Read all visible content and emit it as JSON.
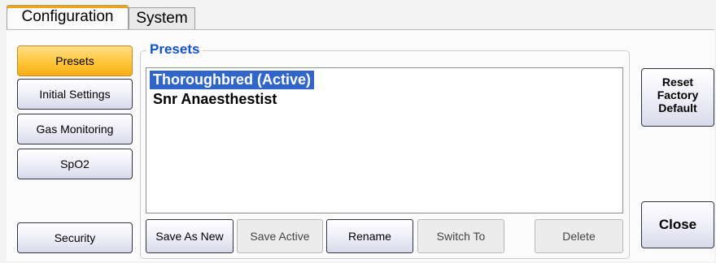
{
  "tabs": [
    {
      "label": "Configuration",
      "active": true
    },
    {
      "label": "System",
      "active": false
    }
  ],
  "sidebar": {
    "items": [
      {
        "label": "Presets",
        "active": true
      },
      {
        "label": "Initial Settings",
        "active": false
      },
      {
        "label": "Gas Monitoring",
        "active": false
      },
      {
        "label": "SpO2",
        "active": false
      }
    ],
    "security_label": "Security"
  },
  "presets": {
    "legend": "Presets",
    "items": [
      {
        "label": "Thoroughbred (Active)",
        "selected": true
      },
      {
        "label": "Snr Anaesthestist",
        "selected": false
      }
    ]
  },
  "actions": [
    {
      "label": "Save As New",
      "enabled": true
    },
    {
      "label": "Save Active",
      "enabled": false
    },
    {
      "label": "Rename",
      "enabled": true
    },
    {
      "label": "Switch To",
      "enabled": false
    },
    {
      "label": "Delete",
      "enabled": false
    }
  ],
  "right_panel": {
    "reset_lines": [
      "Reset",
      "Factory",
      "Default"
    ],
    "close_label": "Close"
  },
  "colors": {
    "active_tab_accent": "#f7a400",
    "selection_highlight": "#2f66c8",
    "legend_text": "#1452c8"
  }
}
